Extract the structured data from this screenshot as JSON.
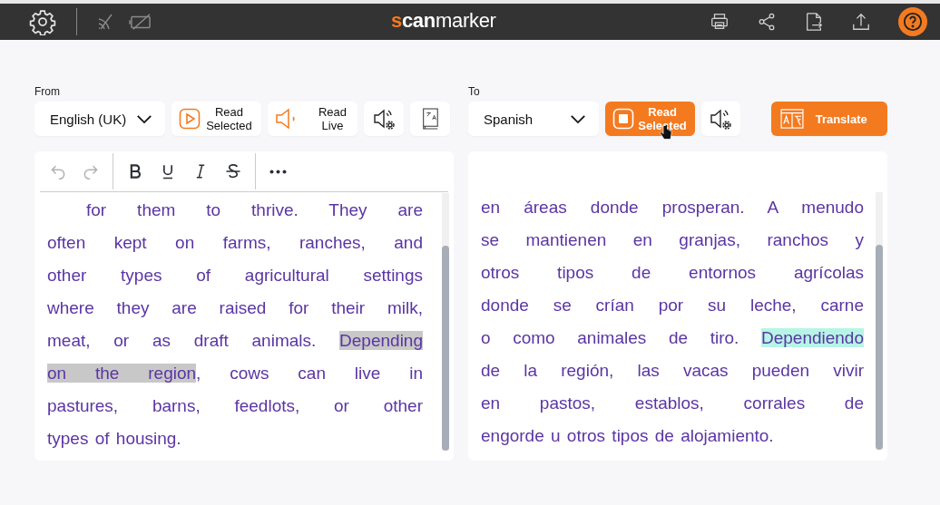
{
  "topbar": {
    "logo": [
      {
        "text": "s",
        "kind": "accent"
      },
      {
        "text": "can",
        "kind": "bold"
      },
      {
        "text": "marker",
        "kind": "plain"
      }
    ]
  },
  "source": {
    "label": "From",
    "language": "English (UK)",
    "buttons": [
      {
        "kind": "read_selected",
        "label": "Read Selected",
        "active": false
      },
      {
        "kind": "read_live",
        "label": "Read Live"
      },
      {
        "kind": "voice_settings"
      },
      {
        "kind": "dictionary"
      }
    ],
    "toolbar": [
      {
        "kind": "undo",
        "disabled": true
      },
      {
        "kind": "redo",
        "disabled": true
      },
      {
        "kind": "bold",
        "disabled": false
      },
      {
        "kind": "underline",
        "disabled": false
      },
      {
        "kind": "italic",
        "disabled": false
      },
      {
        "kind": "strike",
        "disabled": false
      },
      {
        "kind": "more",
        "disabled": false
      }
    ],
    "lines": [
      {
        "segments": [
          {
            "text": "for them to thrive. They are",
            "highlighted": false
          }
        ]
      },
      {
        "segments": [
          {
            "text": "often kept on farms, ranches, and",
            "highlighted": false
          }
        ]
      },
      {
        "segments": [
          {
            "text": "other types of agricultural settings",
            "highlighted": false
          }
        ]
      },
      {
        "segments": [
          {
            "text": "where they are raised for their milk,",
            "highlighted": false
          }
        ]
      },
      {
        "segments": [
          {
            "text": "meat, or as draft animals. ",
            "highlighted": false
          },
          {
            "text": "Depending",
            "highlighted": true
          }
        ]
      },
      {
        "segments": [
          {
            "text": "on the region",
            "highlighted": true
          },
          {
            "text": ", cows can live in",
            "highlighted": false
          }
        ]
      },
      {
        "segments": [
          {
            "text": "pastures, barns, feedlots, or other",
            "highlighted": false
          }
        ]
      },
      {
        "segments": [
          {
            "text": "types of housing.",
            "highlighted": false
          }
        ]
      }
    ]
  },
  "target": {
    "label": "To",
    "language": "Spanish",
    "buttons": [
      {
        "kind": "read_selected",
        "label": "Read Selected",
        "active": true
      },
      {
        "kind": "voice_settings"
      },
      {
        "kind": "translate",
        "label": "Translate"
      }
    ],
    "lines": [
      {
        "segments": [
          {
            "text": "en áreas donde prosperan. A menudo",
            "highlighted": false
          }
        ]
      },
      {
        "segments": [
          {
            "text": "se mantienen en granjas, ranchos y",
            "highlighted": false
          }
        ]
      },
      {
        "segments": [
          {
            "text": "otros tipos de entornos agrícolas",
            "highlighted": false
          }
        ]
      },
      {
        "segments": [
          {
            "text": "donde se crían por su leche, carne",
            "highlighted": false
          }
        ]
      },
      {
        "segments": [
          {
            "text": "o como animales de tiro. ",
            "highlighted": false
          },
          {
            "text": "Dependiendo",
            "highlighted": true
          }
        ]
      },
      {
        "segments": [
          {
            "text": "de la región, las vacas pueden vivir",
            "highlighted": false
          }
        ]
      },
      {
        "segments": [
          {
            "text": "en pastos, establos, corrales de",
            "highlighted": false
          }
        ]
      },
      {
        "segments": [
          {
            "text": "engorde u otros tipos de alojamiento.",
            "highlighted": false
          }
        ]
      }
    ]
  }
}
